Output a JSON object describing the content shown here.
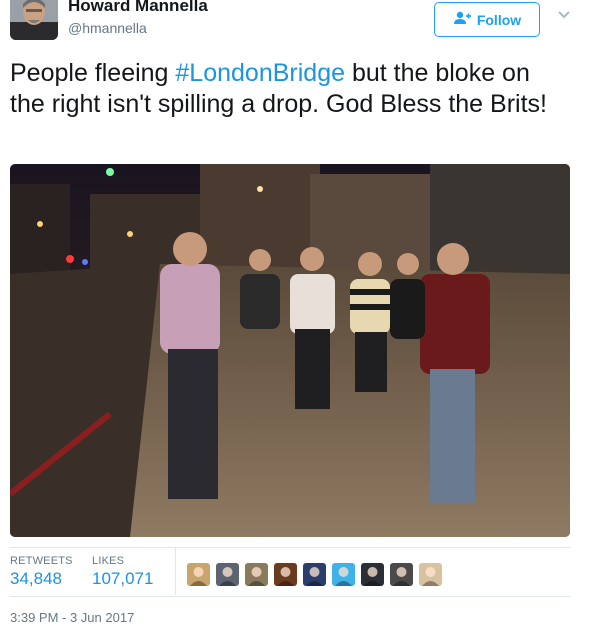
{
  "author": {
    "name": "Howard Mannella",
    "handle": "@hmannella",
    "avatar_icon": "avatar-photo"
  },
  "follow_button": {
    "label": "Follow",
    "icon": "add-user-icon"
  },
  "menu": {
    "icon": "chevron-down-icon"
  },
  "tweet": {
    "text_before": "People fleeing ",
    "hashtag": "#LondonBridge",
    "text_after": " but the bloke on the right isn't spilling a drop. God Bless the Brits!",
    "photo_icon": "street-photo"
  },
  "stats": {
    "retweets_label": "RETWEETS",
    "retweets_value": "34,848",
    "likes_label": "LIKES",
    "likes_value": "107,071"
  },
  "likers": [
    {
      "icon": "liker-avatar-1",
      "color": "#c9a46b"
    },
    {
      "icon": "liker-avatar-2",
      "color": "#5b6470"
    },
    {
      "icon": "liker-avatar-3",
      "color": "#8a7a5c"
    },
    {
      "icon": "liker-avatar-4",
      "color": "#6a3b1e"
    },
    {
      "icon": "liker-avatar-5",
      "color": "#2b3d6b"
    },
    {
      "icon": "liker-avatar-6",
      "color": "#3fb3e8"
    },
    {
      "icon": "liker-avatar-7",
      "color": "#2a2f36"
    },
    {
      "icon": "liker-avatar-8",
      "color": "#4a4a4a"
    },
    {
      "icon": "liker-avatar-9",
      "color": "#d9c2a0"
    }
  ],
  "timestamp": "3:39 PM - 3 Jun 2017",
  "colors": {
    "accent": "#1da1f2",
    "link": "#1b95e0",
    "muted": "#657786",
    "divider": "#e1e8ed"
  }
}
